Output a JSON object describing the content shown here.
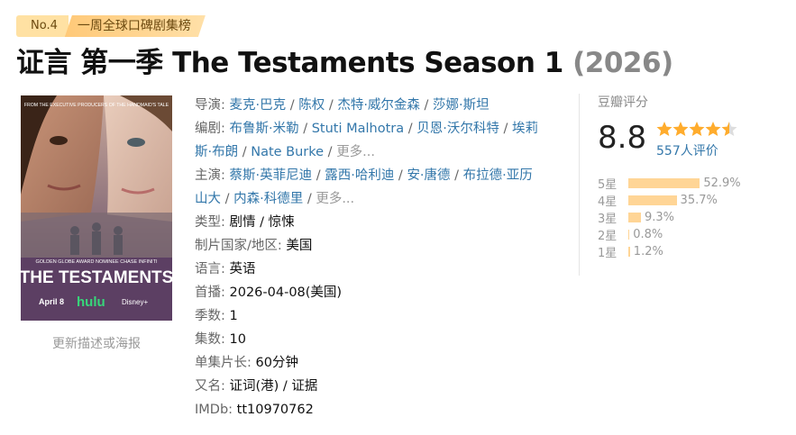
{
  "badge": {
    "rank": "No.4",
    "list": "一周全球口碑剧集榜"
  },
  "title": {
    "main": "证言 第一季 The Testaments Season 1",
    "year": "(2026)"
  },
  "poster": {
    "tagline": "FROM THE EXECUTIVE PRODUCERS OF THE HANDMAID'S TALE",
    "credit": "GOLDEN GLOBE AWARD NOMINEE CHASE INFINITI",
    "show_title": "THE TESTAMENTS",
    "date": "April 8",
    "network": "hulu",
    "partner": "Disney+",
    "update_link": "更新描述或海报"
  },
  "info": {
    "director_label": "导演",
    "directors": [
      "麦克·巴克",
      "陈权",
      "杰特·威尔金森",
      "莎娜·斯坦"
    ],
    "writer_label": "编剧",
    "writers_line1": [
      "布鲁斯·米勒",
      "Stuti Malhotra",
      "贝恩·沃尔科特",
      "埃莉"
    ],
    "writers_line2": [
      "斯·布朗",
      "Nate Burke"
    ],
    "cast_label": "主演",
    "cast_line1": [
      "蔡斯·英菲尼迪",
      "露西·哈利迪",
      "安·唐德",
      "布拉德·亚历"
    ],
    "cast_line2": [
      "山大",
      "内森·科德里"
    ],
    "more": "更多...",
    "genre_label": "类型:",
    "genres": [
      "剧情",
      "惊悚"
    ],
    "country_label": "制片国家/地区:",
    "country": "美国",
    "language_label": "语言:",
    "language": "英语",
    "premiere_label": "首播:",
    "premiere": "2026-04-08(美国)",
    "seasons_label": "季数:",
    "seasons": "1",
    "episodes_label": "集数:",
    "episodes": "10",
    "runtime_label": "单集片长:",
    "runtime": "60分钟",
    "aka_label": "又名:",
    "aka": "证词(港) / 证据",
    "imdb_label": "IMDb:",
    "imdb": "tt10970762"
  },
  "rating": {
    "title": "豆瓣评分",
    "score": "8.8",
    "stars": 4.5,
    "votes": "557人评价",
    "distribution": [
      {
        "label": "5星",
        "percent": 52.9,
        "text": "52.9%"
      },
      {
        "label": "4星",
        "percent": 35.7,
        "text": "35.7%"
      },
      {
        "label": "3星",
        "percent": 9.3,
        "text": "9.3%"
      },
      {
        "label": "2星",
        "percent": 0.8,
        "text": "0.8%"
      },
      {
        "label": "1星",
        "percent": 1.2,
        "text": "1.2%"
      }
    ]
  },
  "colors": {
    "link": "#3377aa",
    "star": "#ffac2d",
    "bar": "#ffd596",
    "badge": "#ffc978"
  }
}
